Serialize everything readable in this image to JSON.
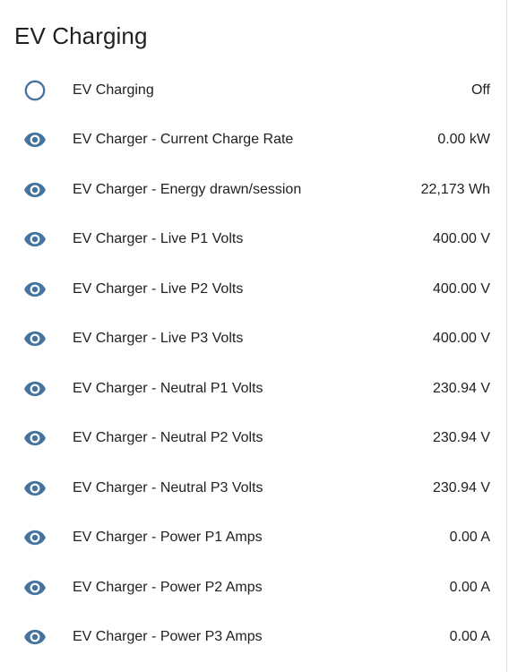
{
  "card": {
    "title": "EV Charging"
  },
  "colors": {
    "icon": "#44739e",
    "text": "#212121",
    "background": "#ffffff"
  },
  "entities": [
    {
      "icon": "circle-outline-icon",
      "name": "EV Charging",
      "state": "Off"
    },
    {
      "icon": "eye-icon",
      "name": "EV Charger - Current Charge Rate",
      "state": "0.00 kW"
    },
    {
      "icon": "eye-icon",
      "name": "EV Charger - Energy drawn/session",
      "state": "22,173 Wh"
    },
    {
      "icon": "eye-icon",
      "name": "EV Charger - Live P1 Volts",
      "state": "400.00 V"
    },
    {
      "icon": "eye-icon",
      "name": "EV Charger - Live P2 Volts",
      "state": "400.00 V"
    },
    {
      "icon": "eye-icon",
      "name": "EV Charger - Live P3 Volts",
      "state": "400.00 V"
    },
    {
      "icon": "eye-icon",
      "name": "EV Charger - Neutral P1 Volts",
      "state": "230.94 V"
    },
    {
      "icon": "eye-icon",
      "name": "EV Charger - Neutral P2 Volts",
      "state": "230.94 V"
    },
    {
      "icon": "eye-icon",
      "name": "EV Charger - Neutral P3 Volts",
      "state": "230.94 V"
    },
    {
      "icon": "eye-icon",
      "name": "EV Charger - Power P1 Amps",
      "state": "0.00 A"
    },
    {
      "icon": "eye-icon",
      "name": "EV Charger - Power P2 Amps",
      "state": "0.00 A"
    },
    {
      "icon": "eye-icon",
      "name": "EV Charger - Power P3 Amps",
      "state": "0.00 A"
    }
  ]
}
